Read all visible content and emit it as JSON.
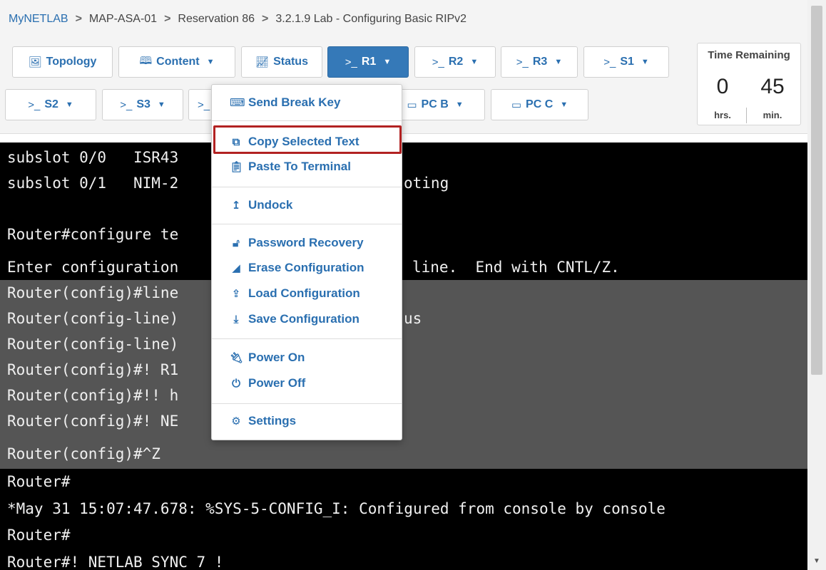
{
  "breadcrumb": {
    "items": [
      "MyNETLAB",
      "MAP-ASA-01",
      "Reservation 86",
      "3.2.1.9 Lab - Configuring Basic RIPv2"
    ],
    "separator": ">"
  },
  "tabs": {
    "topology": "Topology",
    "content": "Content",
    "status": "Status",
    "r1": "R1",
    "r2": "R2",
    "r3": "R3",
    "s1": "S1",
    "s2": "S2",
    "s3": "S3",
    "hidden_prefix": ">_",
    "pcb": "PC B",
    "pcc": "PC C",
    "console_prefix": ">_"
  },
  "time": {
    "title": "Time Remaining",
    "hours": "0",
    "minutes": "45",
    "hours_label": "hrs.",
    "minutes_label": "min."
  },
  "menu": {
    "send_break": "Send Break Key",
    "copy": "Copy Selected Text",
    "paste": "Paste To Terminal",
    "undock": "Undock",
    "password_recovery": "Password Recovery",
    "erase": "Erase Configuration",
    "load": "Load Configuration",
    "save": "Save Configuration",
    "power_on": "Power On",
    "power_off": "Power Off",
    "settings": "Settings"
  },
  "terminal": {
    "lines": [
      "subslot 0/0   ISR43",
      "subslot 0/1   NIM-2",
      "",
      "Router#configure te",
      "Enter configuration",
      "Router(config)#line",
      "Router(config-line)",
      "Router(config-line)",
      "Router(config)#! R1",
      "Router(config)#!! h",
      "Router(config)#! NE",
      "Router(config)#^Z",
      "Router#",
      "*May 31 15:07:47.678: %SYS-5-CONFIG_I: Configured from console by console",
      "Router#",
      "Router#! NETLAB SYNC 7 !"
    ],
    "right_fragments": {
      "line1": "oting",
      "line4": "line.  End with CNTL/Z.",
      "line6": "us"
    }
  },
  "colors": {
    "accent": "#3579b8",
    "highlight_border": "#b22222",
    "selection": "#555555"
  }
}
